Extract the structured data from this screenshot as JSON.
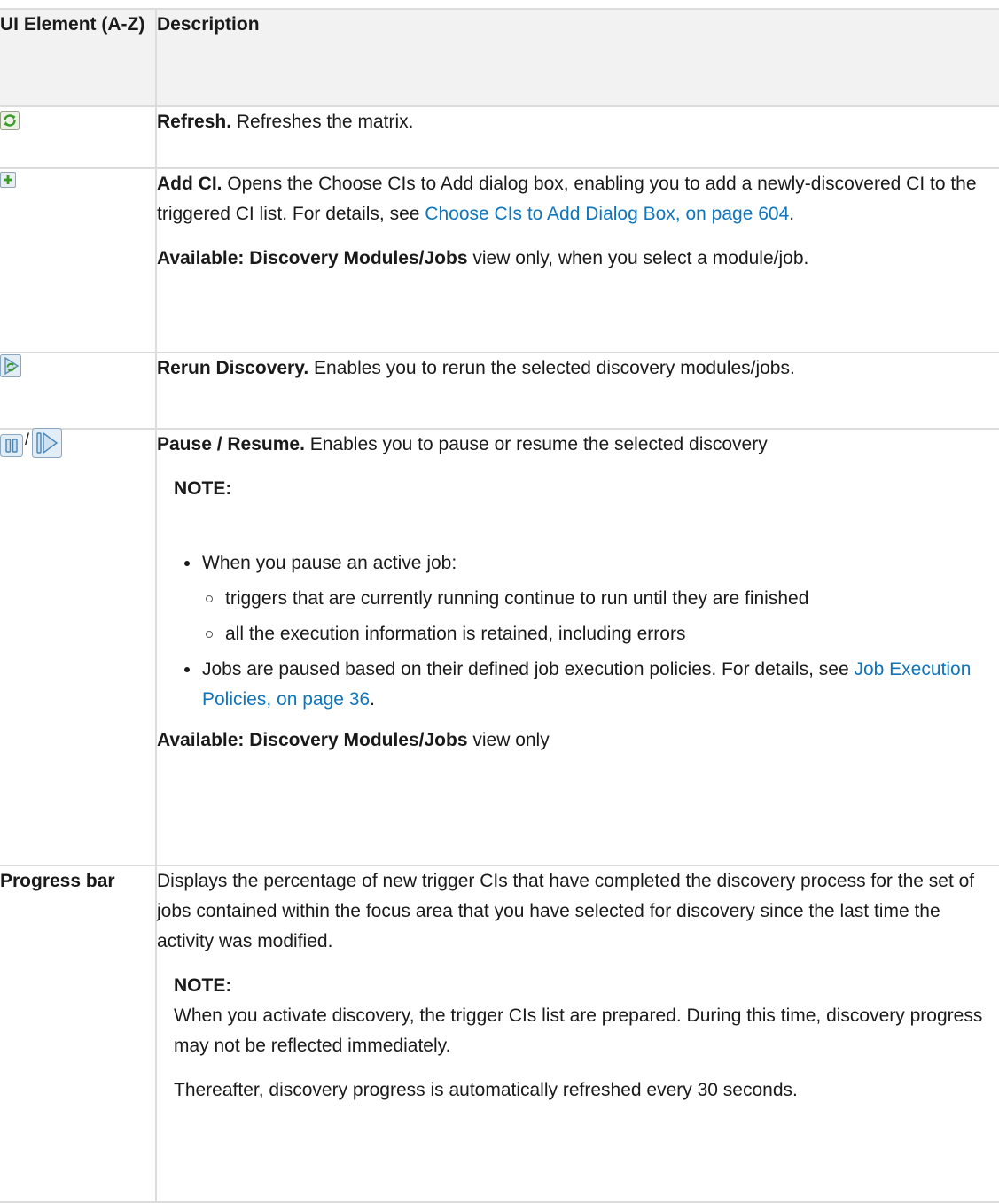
{
  "header": {
    "col1": "UI Element (A-Z)",
    "col2": "Description"
  },
  "rows": {
    "refresh": {
      "icon": "refresh-icon",
      "title": "Refresh.",
      "text": " Refreshes the matrix."
    },
    "add_ci": {
      "icon": "add-icon",
      "title": "Add CI.",
      "text": " Opens the Choose CIs to Add dialog box, enabling you to add a newly-discovered CI to the triggered CI list. For details, see ",
      "link": "Choose CIs to Add Dialog Box, on page 604",
      "text_after": ".",
      "avail_label": "Available: Discovery Modules/Jobs",
      "avail_text": " view only, when you select a module/job."
    },
    "rerun": {
      "icon": "rerun-discovery-icon",
      "title": "Rerun Discovery.",
      "text": " Enables you to rerun the selected discovery modules/jobs."
    },
    "pause_resume": {
      "icons": [
        "pause-icon",
        "resume-icon"
      ],
      "separator": "/",
      "title": "Pause / Resume.",
      "text": " Enables you to pause or resume the selected discovery",
      "note_title": "NOTE:",
      "bullet1": "When you pause an active job:",
      "sub1": "triggers that are currently running continue to run until they are finished",
      "sub2": "all the execution information is retained, including errors",
      "bullet2_text": "Jobs are paused based on their defined job execution policies. For details, see ",
      "bullet2_link": "Job Execution Policies, on page 36",
      "bullet2_after": ".",
      "avail_label": "Available: Discovery Modules/Jobs",
      "avail_text": " view only"
    },
    "progress": {
      "label": "Progress bar",
      "text": "Displays the percentage of new trigger CIs that have completed the discovery process for the set of jobs contained within the focus area that you have selected for discovery since the last time the activity was modified.",
      "note_title": "NOTE:",
      "note_text": "When you activate discovery, the trigger CIs list are prepared. During this time, discovery progress may not be reflected immediately.",
      "note_text2": "Thereafter, discovery progress is automatically refreshed every 30 seconds."
    }
  },
  "colors": {
    "link": "#0f75bc",
    "header_bg": "#f2f2f2",
    "border": "#dcdcdc"
  }
}
